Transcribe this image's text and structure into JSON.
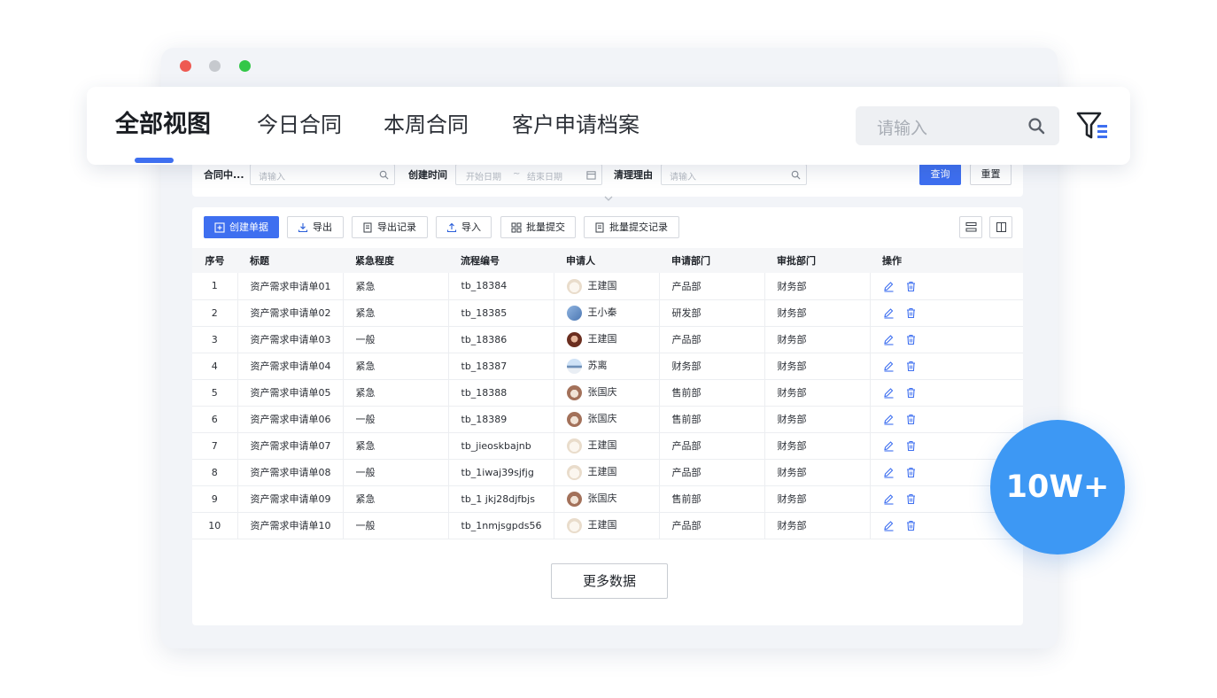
{
  "tabs": [
    {
      "label": "全部视图",
      "active": true
    },
    {
      "label": "今日合同",
      "active": false
    },
    {
      "label": "本周合同",
      "active": false
    },
    {
      "label": "客户申请档案",
      "active": false
    }
  ],
  "search": {
    "placeholder": "请输入"
  },
  "filters": {
    "contract_label": "合同中...",
    "contract_placeholder": "请输入",
    "created_label": "创建时间",
    "start_placeholder": "开始日期",
    "range_sep": "~",
    "end_placeholder": "结束日期",
    "reason_label": "清理理由",
    "reason_placeholder": "请输入",
    "query_button": "查询",
    "reset_button": "重置"
  },
  "toolbar": {
    "create": "创建单据",
    "export": "导出",
    "export_log": "导出记录",
    "import": "导入",
    "batch_submit": "批量提交",
    "batch_submit_log": "批量提交记录"
  },
  "table": {
    "columns": [
      "序号",
      "标题",
      "紧急程度",
      "流程编号",
      "申请人",
      "申请部门",
      "审批部门",
      "操作"
    ],
    "rows": [
      {
        "idx": "1",
        "title": "资产需求申请单01",
        "urgency": "紧急",
        "flow": "tb_18384",
        "applicant": "王建国",
        "avatar": "dog",
        "dept": "产品部",
        "approve": "财务部"
      },
      {
        "idx": "2",
        "title": "资产需求申请单02",
        "urgency": "紧急",
        "flow": "tb_18385",
        "applicant": "王小秦",
        "avatar": "blue",
        "dept": "研发部",
        "approve": "财务部"
      },
      {
        "idx": "3",
        "title": "资产需求申请单03",
        "urgency": "一般",
        "flow": "tb_18386",
        "applicant": "王建国",
        "avatar": "girl",
        "dept": "产品部",
        "approve": "财务部"
      },
      {
        "idx": "4",
        "title": "资产需求申请单04",
        "urgency": "紧急",
        "flow": "tb_18387",
        "applicant": "苏离",
        "avatar": "sea",
        "dept": "财务部",
        "approve": "财务部"
      },
      {
        "idx": "5",
        "title": "资产需求申请单05",
        "urgency": "紧急",
        "flow": "tb_18388",
        "applicant": "张国庆",
        "avatar": "cat",
        "dept": "售前部",
        "approve": "财务部"
      },
      {
        "idx": "6",
        "title": "资产需求申请单06",
        "urgency": "一般",
        "flow": "tb_18389",
        "applicant": "张国庆",
        "avatar": "cat",
        "dept": "售前部",
        "approve": "财务部"
      },
      {
        "idx": "7",
        "title": "资产需求申请单07",
        "urgency": "紧急",
        "flow": "tb_jieoskbajnb",
        "applicant": "王建国",
        "avatar": "dog",
        "dept": "产品部",
        "approve": "财务部"
      },
      {
        "idx": "8",
        "title": "资产需求申请单08",
        "urgency": "一般",
        "flow": "tb_1iwaj39sjfjg",
        "applicant": "王建国",
        "avatar": "dog",
        "dept": "产品部",
        "approve": "财务部"
      },
      {
        "idx": "9",
        "title": "资产需求申请单09",
        "urgency": "紧急",
        "flow": "tb_1 jkj28djfbjs",
        "applicant": "张国庆",
        "avatar": "cat",
        "dept": "售前部",
        "approve": "财务部"
      },
      {
        "idx": "10",
        "title": "资产需求申请单10",
        "urgency": "一般",
        "flow": "tb_1nmjsgpds56",
        "applicant": "王建国",
        "avatar": "dog",
        "dept": "产品部",
        "approve": "财务部"
      }
    ]
  },
  "more_button": "更多数据",
  "badge": "10W+",
  "colors": {
    "accent": "#3e6ff0",
    "badge": "#3d98f4"
  },
  "icons": {
    "search": "search-icon",
    "filter": "filter-list-icon",
    "edit": "edit-icon",
    "delete": "trash-icon"
  }
}
